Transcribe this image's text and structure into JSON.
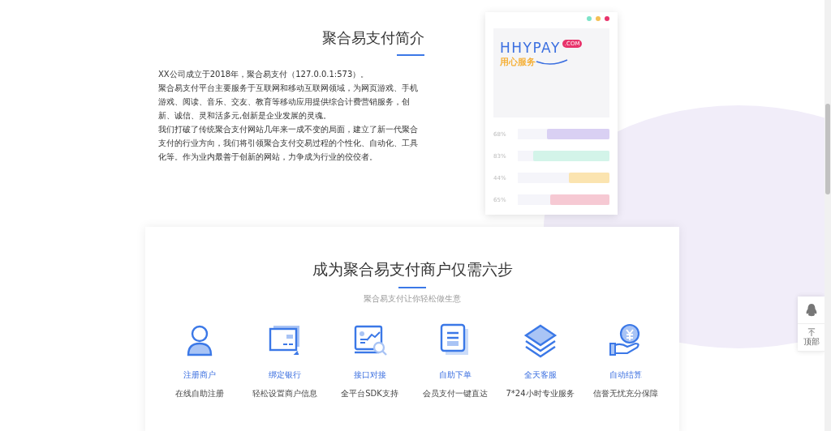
{
  "intro": {
    "title": "聚合易支付简介",
    "paragraphs": [
      "XX公司成立于2018年，聚合易支付（127.0.0.1:573）。",
      "聚合易支付平台主要服务于互联网和移动互联网领域，为网页游戏、手机游戏、阅读、音乐、交友、教育等移动应用提供综合计费营销服务，创新、诚信、灵和活多元,创新是企业发展的灵魂。",
      "我们打破了传统聚合支付网站几年来一成不变的局面，建立了新一代聚合支付的行业方向，我们将引领聚合支付交易过程的个性化、自动化、工具化等。作为业内最善于创新的网站，力争成为行业的佼佼者。"
    ]
  },
  "mockup": {
    "logo": "HHYPAY",
    "logo_badge": ".COM",
    "slogan": "用心服务",
    "window_dots": [
      {
        "color": "#7de3c8"
      },
      {
        "color": "#f5c055"
      },
      {
        "color": "#e8336b"
      }
    ],
    "bars": [
      {
        "reading": "68%",
        "level": 0.68,
        "color": "#d9d0f3"
      },
      {
        "reading": "83%",
        "level": 0.83,
        "color": "#d3f4e9"
      },
      {
        "reading": "44%",
        "level": 0.44,
        "color": "#fbe4b0"
      },
      {
        "reading": "65%",
        "level": 0.65,
        "color": "#f6c9d3"
      }
    ]
  },
  "steps_section": {
    "title": "成为聚合易支付商户仅需六步",
    "subtitle": "聚合易支付让你轻松做生意",
    "steps": [
      {
        "kind": "user",
        "title": "注册商户",
        "text": "在线自助注册"
      },
      {
        "kind": "card",
        "title": "绑定银行",
        "text": "轻松设置商户信息"
      },
      {
        "kind": "chart",
        "title": "接口对接",
        "text": "全平台SDK支持"
      },
      {
        "kind": "doc",
        "title": "自助下单",
        "text": "会员支付一键直达"
      },
      {
        "kind": "layers",
        "title": "全天客服",
        "text": "7*24小时专业服务"
      },
      {
        "kind": "coin",
        "title": "自动结算",
        "text": "信誉无忧充分保障"
      }
    ]
  },
  "side_widget": {
    "top_label": "顶部"
  }
}
